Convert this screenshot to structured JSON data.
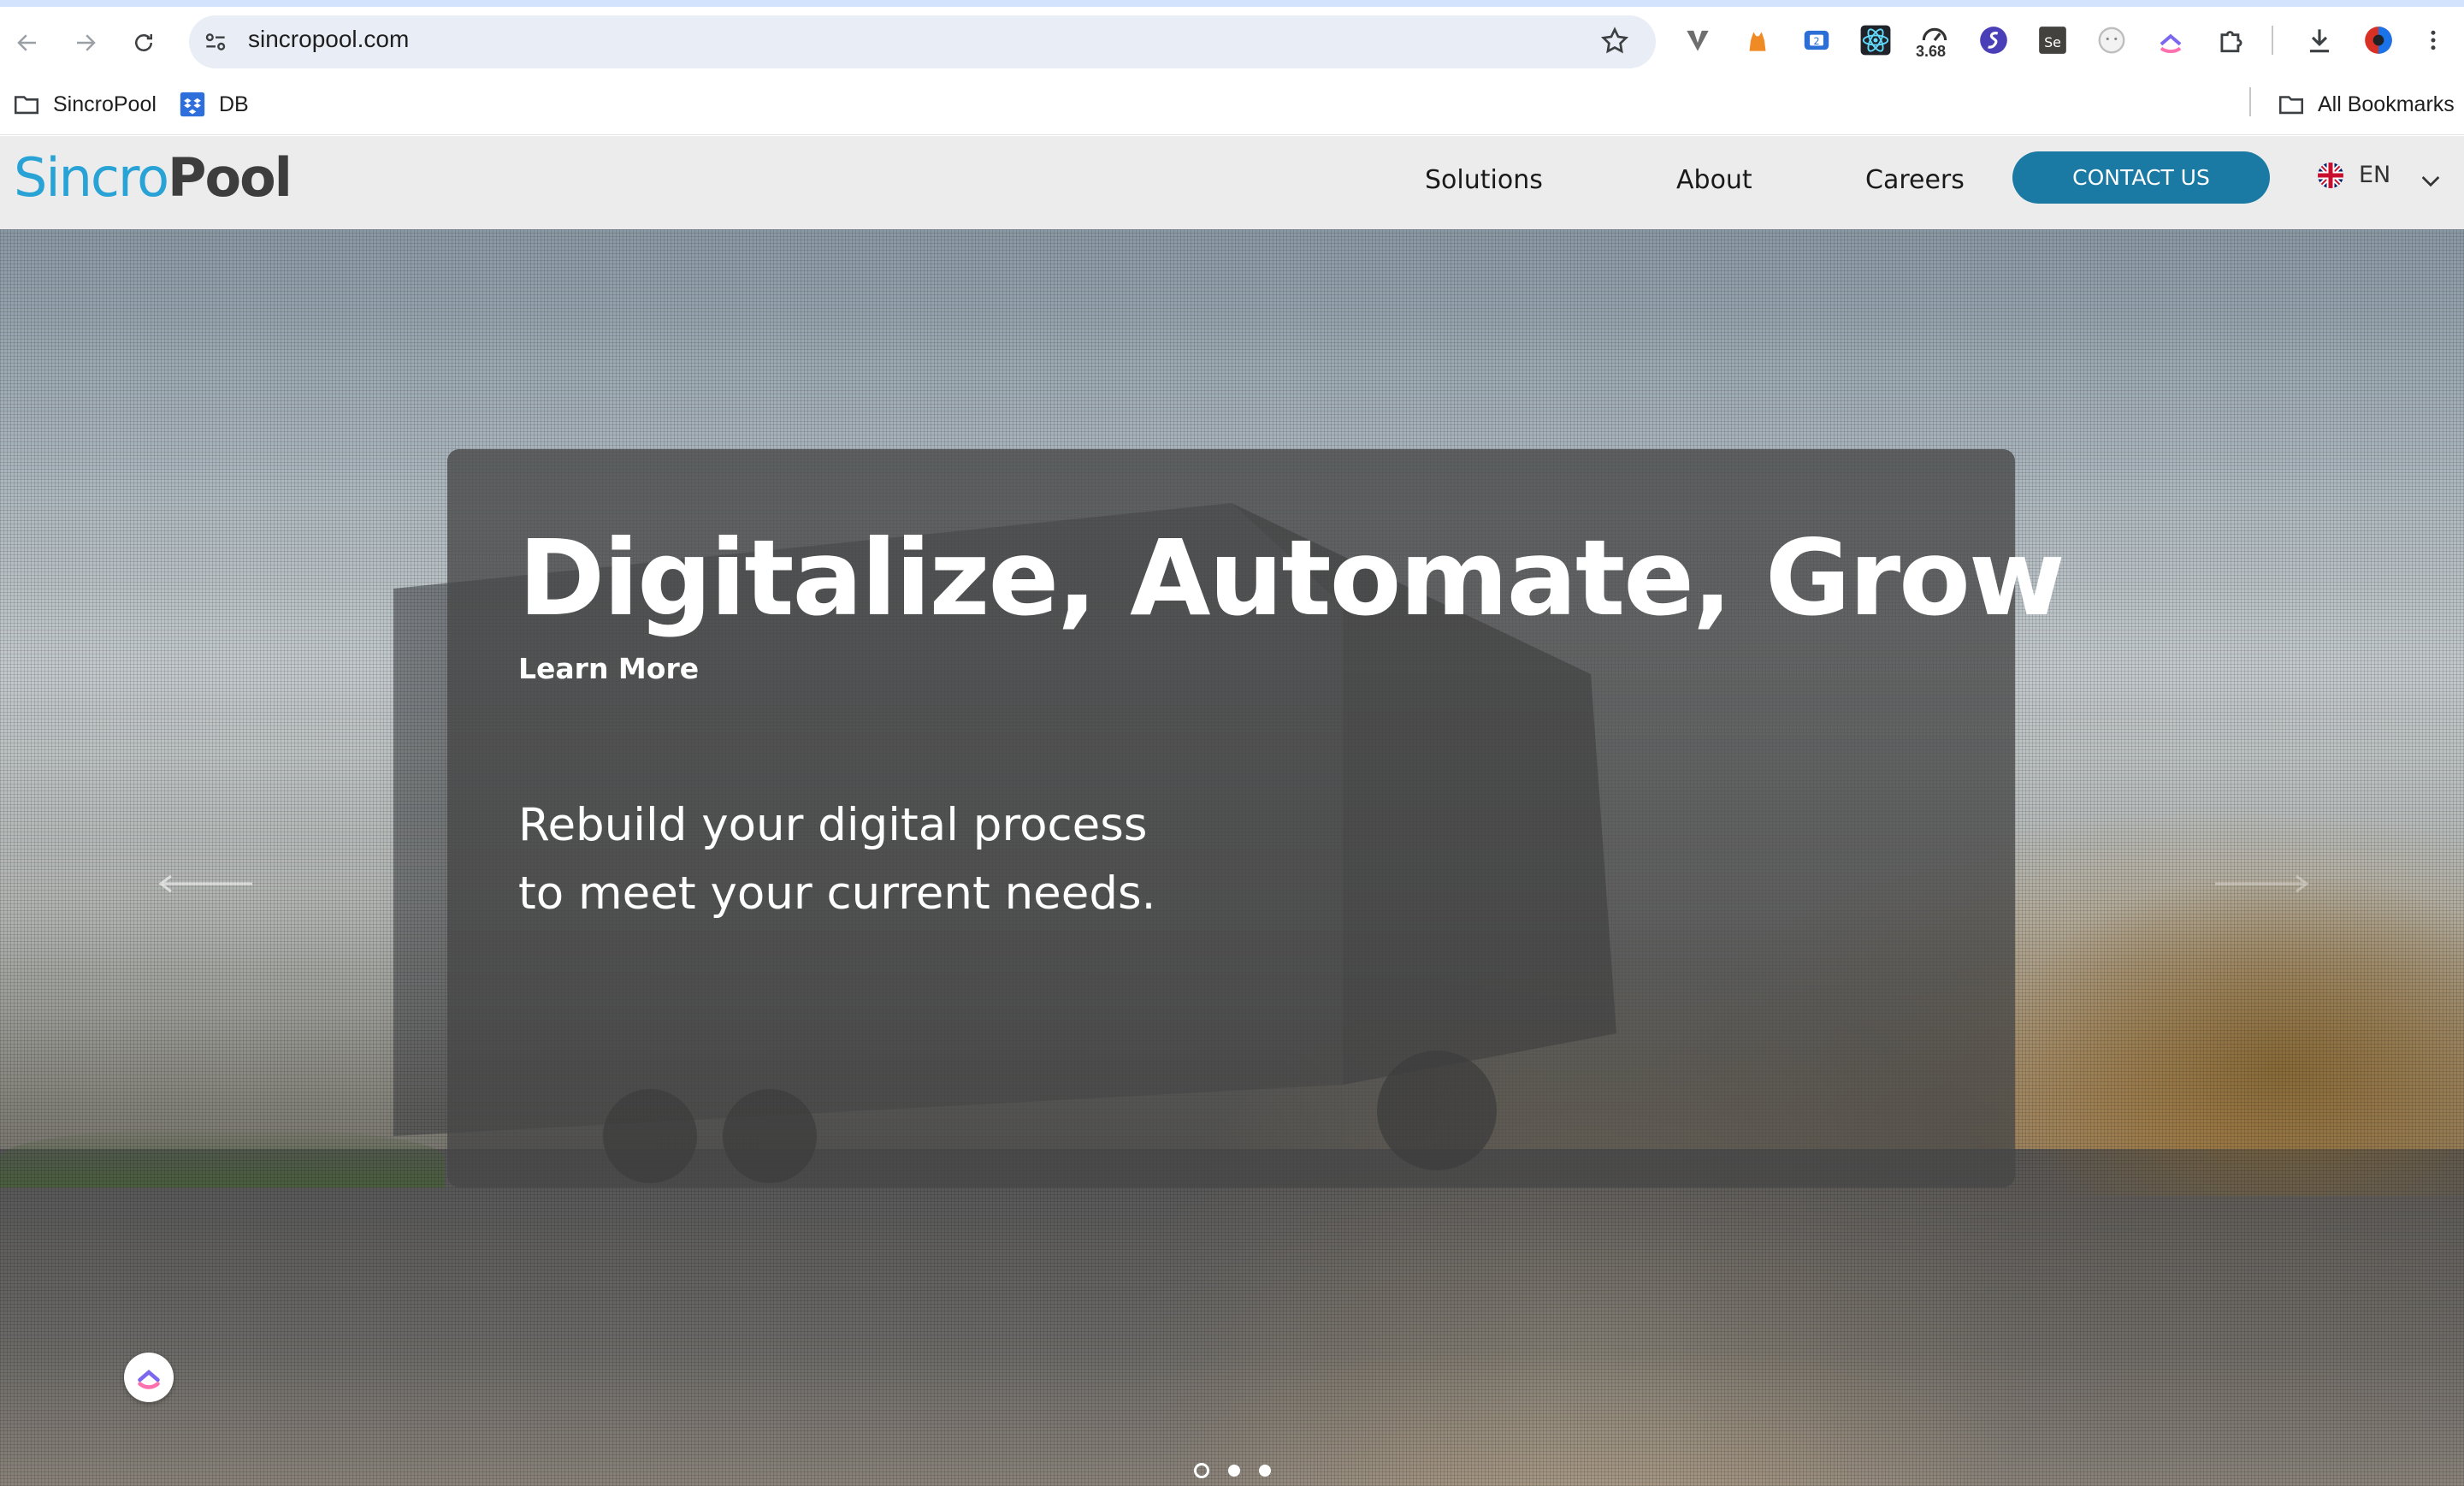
{
  "browser": {
    "url": "sincropool.com",
    "extension_badge": "3.68",
    "icons": [
      "back-icon",
      "forward-icon",
      "reload-icon",
      "site-info-icon",
      "bookmark-star-icon",
      "extension-v-icon",
      "extension-cat-icon",
      "extension-tab-icon",
      "react-devtools-icon",
      "extension-speed-icon",
      "extension-s-icon",
      "selenium-icon",
      "extension-face-icon",
      "clickup-extension-icon",
      "extensions-puzzle-icon",
      "download-icon",
      "profile-icon",
      "menu-kebab-icon"
    ]
  },
  "bookmarks": {
    "items": [
      {
        "label": "SincroPool",
        "icon": "folder-icon"
      },
      {
        "label": "DB",
        "icon": "dropbox-icon"
      }
    ],
    "all_label": "All Bookmarks"
  },
  "site": {
    "logo": {
      "part1": "Sincro",
      "part2": "Pool"
    },
    "nav": {
      "solutions": "Solutions",
      "about": "About",
      "careers": "Careers"
    },
    "contact_label": "CONTACT US",
    "language": "EN"
  },
  "hero": {
    "title": "Digitalize, Automate, Grow",
    "cta": "Learn More",
    "subtitle_line1": "Rebuild your digital process",
    "subtitle_line2": "to meet your current needs.",
    "slides_total": 3,
    "active_slide": 1
  },
  "colors": {
    "brand_blue": "#29a3d6",
    "contact_button": "#1a7aa3",
    "header_bg": "#ececec"
  }
}
